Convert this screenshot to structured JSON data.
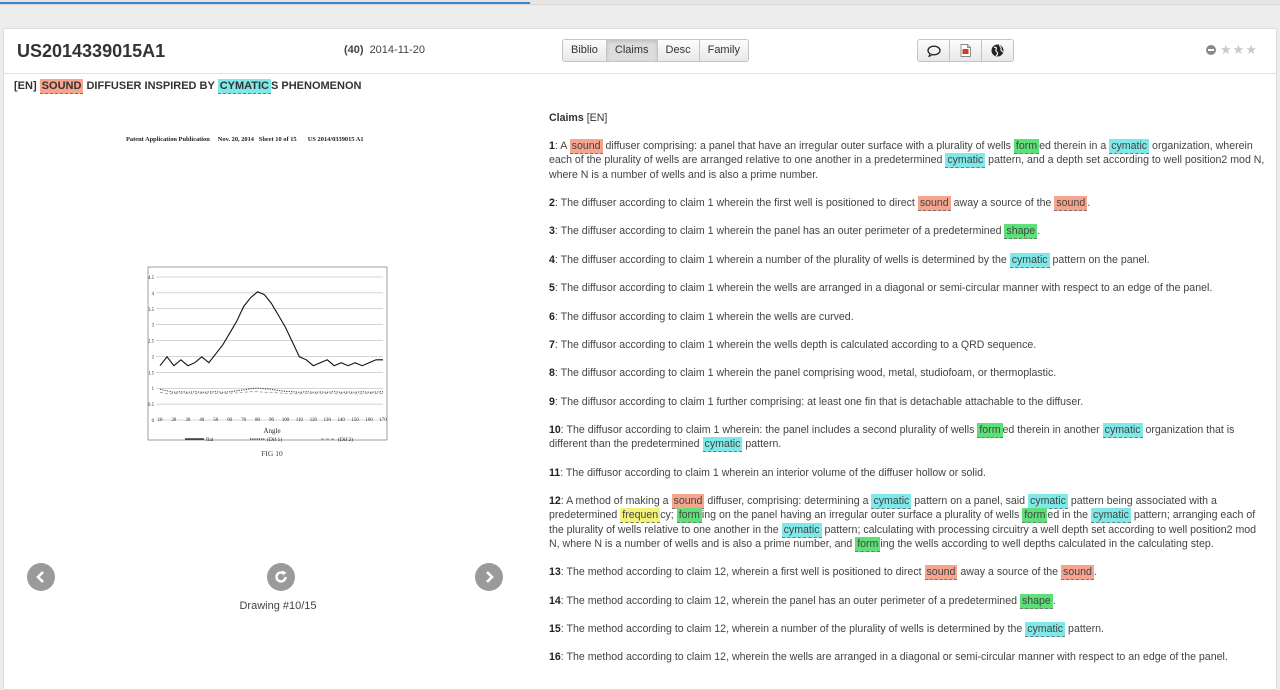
{
  "progress": {
    "fraction": 0.414
  },
  "document": {
    "pub_number": "US2014339015A1",
    "date_code": "(40)",
    "date": "2014-11-20",
    "title": {
      "lang": "[EN]",
      "hl1": "SOUND",
      "mid": "DIFFUSER INSPIRED BY",
      "hl2": "CYMATIC",
      "end": "S PHENOMENON"
    }
  },
  "tabs": [
    "Biblio",
    "Claims",
    "Desc",
    "Family"
  ],
  "active_tab": "Claims",
  "actions": [
    "comment-icon",
    "pdf-icon",
    "globe-icon"
  ],
  "rating": {
    "stars": 0,
    "max": 3
  },
  "drawing": {
    "header": "Patent Application Publication     Nov. 20, 2014   Sheet 10 of 15       US 2014/0339015 A1",
    "yticks": [
      "4.5",
      "4",
      "3.5",
      "3",
      "2.5",
      "2",
      "1.5",
      "1",
      "0.5",
      "0"
    ],
    "xticks": [
      "10",
      "20",
      "30",
      "40",
      "50",
      "60",
      "70",
      "80",
      "90",
      "100",
      "110",
      "120",
      "130",
      "140",
      "150",
      "160",
      "170"
    ],
    "xlabel": "Angle",
    "legend": [
      "flat",
      "(Dif 1)",
      "(Dif 2)"
    ],
    "fig_label": "FIG 10",
    "caption": "Drawing #10/15"
  },
  "highlight_colors": {
    "sound": "#f6a48e",
    "cymatic": "#7fe8e8",
    "form": "#5ee078",
    "frequen": "#f3f37a"
  },
  "claims_heading": {
    "label": "Claims",
    "lang": "[EN]"
  },
  "claims": [
    {
      "num": "1",
      "parts": [
        [
          ": A "
        ],
        [
          "sound",
          "r"
        ],
        [
          " diffuser comprising: a panel that have an irregular outer surface with a plurality of wells "
        ],
        [
          "form",
          "g"
        ],
        [
          "ed therein in a "
        ],
        [
          "cymatic",
          "c"
        ],
        [
          " organization, wherein each of the plurality of wells are arranged relative to one another in a predetermined "
        ],
        [
          "cymatic",
          "c"
        ],
        [
          " pattern, and a depth set according to well position2 mod N, where N is a number of wells and is also a prime number."
        ]
      ]
    },
    {
      "num": "2",
      "parts": [
        [
          ": The diffuser according to claim 1 wherein the first well is positioned to direct "
        ],
        [
          "sound",
          "r"
        ],
        [
          " away a source of the "
        ],
        [
          "sound",
          "r"
        ],
        [
          "."
        ]
      ]
    },
    {
      "num": "3",
      "parts": [
        [
          ": The diffuser according to claim 1 wherein the panel has an outer perimeter of a predetermined "
        ],
        [
          "shape",
          "g"
        ],
        [
          "."
        ]
      ]
    },
    {
      "num": "4",
      "parts": [
        [
          ": The diffuser according to claim 1 wherein a number of the plurality of wells is determined by the "
        ],
        [
          "cymatic",
          "c"
        ],
        [
          " pattern on the panel."
        ]
      ]
    },
    {
      "num": "5",
      "parts": [
        [
          ": The diffusor according to claim 1 wherein the wells are arranged in a diagonal or semi-circular manner with respect to an edge of the panel."
        ]
      ]
    },
    {
      "num": "6",
      "parts": [
        [
          ": The diffusor according to claim 1 wherein the wells are curved."
        ]
      ]
    },
    {
      "num": "7",
      "parts": [
        [
          ": The diffusor according to claim 1 wherein the wells depth is calculated according to a QRD sequence."
        ]
      ]
    },
    {
      "num": "8",
      "parts": [
        [
          ": The diffusor according to claim 1 wherein the panel comprising wood, metal, studiofoam, or thermoplastic."
        ]
      ]
    },
    {
      "num": "9",
      "parts": [
        [
          ": The diffusor according to claim 1 further comprising: at least one fin that is detachable attachable to the diffuser."
        ]
      ]
    },
    {
      "num": "10",
      "parts": [
        [
          ": The diffusor according to claim 1 wherein: the panel includes a second plurality of wells "
        ],
        [
          "form",
          "g"
        ],
        [
          "ed therein in another "
        ],
        [
          "cymatic",
          "c"
        ],
        [
          " organization that is different than the predetermined "
        ],
        [
          "cymatic",
          "c"
        ],
        [
          " pattern."
        ]
      ]
    },
    {
      "num": "11",
      "parts": [
        [
          ": The diffusor according to claim 1 wherein an interior volume of the diffuser hollow or solid."
        ]
      ]
    },
    {
      "num": "12",
      "parts": [
        [
          ": A method of making a "
        ],
        [
          "sound",
          "r"
        ],
        [
          " diffuser, comprising: determining a "
        ],
        [
          "cymatic",
          "c"
        ],
        [
          " pattern on a panel, said "
        ],
        [
          "cymatic",
          "c"
        ],
        [
          " pattern being associated with a predetermined "
        ],
        [
          "frequen",
          "y"
        ],
        [
          "cy; "
        ],
        [
          "form",
          "g"
        ],
        [
          "ing on the panel having an irregular outer surface a plurality of wells "
        ],
        [
          "form",
          "g"
        ],
        [
          "ed in the "
        ],
        [
          "cymatic",
          "c"
        ],
        [
          " pattern; arranging each of the plurality of wells relative to one another in the "
        ],
        [
          "cymatic",
          "c"
        ],
        [
          " pattern; calculating with processing circuitry a well depth set according to well position2 mod N, where N is a number of wells and is also a prime number, and "
        ],
        [
          "form",
          "g"
        ],
        [
          "ing the wells according to well depths calculated in the calculating step."
        ]
      ]
    },
    {
      "num": "13",
      "parts": [
        [
          ": The method according to claim 12, wherein a first well is positioned to direct "
        ],
        [
          "sound",
          "r"
        ],
        [
          " away a source of the "
        ],
        [
          "sound",
          "r"
        ],
        [
          "."
        ]
      ]
    },
    {
      "num": "14",
      "parts": [
        [
          ": The method according to claim 12, wherein the panel has an outer perimeter of a predetermined "
        ],
        [
          "shape",
          "g"
        ],
        [
          "."
        ]
      ]
    },
    {
      "num": "15",
      "parts": [
        [
          ": The method according to claim 12, wherein a number of the plurality of wells is determined by the "
        ],
        [
          "cymatic",
          "c"
        ],
        [
          " pattern."
        ]
      ]
    },
    {
      "num": "16",
      "parts": [
        [
          ": The method according to claim 12, wherein the wells are arranged in a diagonal or semi-circular manner with respect to an edge of the panel."
        ]
      ]
    }
  ]
}
